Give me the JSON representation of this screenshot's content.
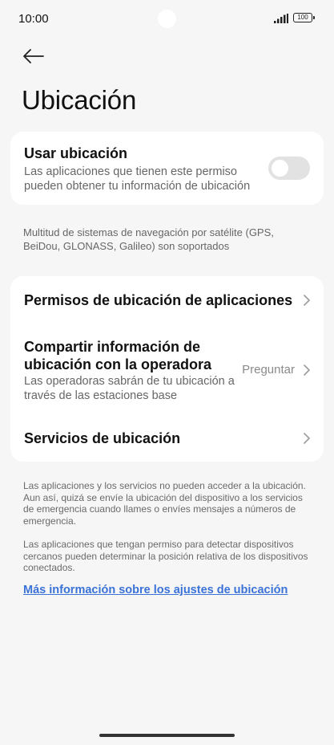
{
  "status_bar": {
    "time": "10:00",
    "battery": "100"
  },
  "page": {
    "title": "Ubicación"
  },
  "location_toggle": {
    "title": "Usar ubicación",
    "subtitle": "Las aplicaciones que tienen este permiso pueden obtener tu información de ubicación",
    "enabled": false
  },
  "gnss_note": "Multitud de sistemas de navegación por satélite (GPS, BeiDou, GLONASS, Galileo) son soportados",
  "settings": {
    "app_permissions": {
      "title": "Permisos de ubicación de aplicaciones"
    },
    "carrier_sharing": {
      "title": "Compartir información de ubicación con la operadora",
      "subtitle": "Las operadoras sabrán de tu ubicación a través de las estaciones base",
      "value": "Preguntar"
    },
    "location_services": {
      "title": "Servicios de ubicación"
    }
  },
  "footer": {
    "emergency_note": "Las aplicaciones y los servicios no pueden acceder a la ubicación. Aun así, quizá se envíe la ubicación del dispositivo a los servicios de emergencia cuando llames o envíes mensajes a números de emergencia.",
    "nearby_note": "Las aplicaciones que tengan permiso para detectar dispositivos cercanos pueden determinar la posición relativa de los dispositivos conectados.",
    "link": "Más información sobre los ajustes de ubicación"
  },
  "colors": {
    "background": "#f6f6f6",
    "card": "#ffffff",
    "link": "#3a72d8",
    "toggle_off": "#e2e2e2"
  }
}
